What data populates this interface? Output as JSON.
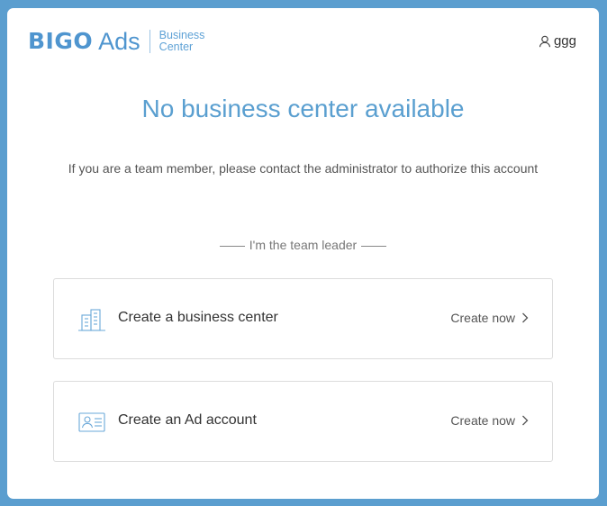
{
  "header": {
    "logo_brand": "BIGO",
    "logo_product": "Ads",
    "logo_sub_line1": "Business",
    "logo_sub_line2": "Center",
    "user_icon": "user-icon",
    "username": "ggg"
  },
  "main": {
    "title": "No business center available",
    "subtitle": "If you are a team member, please contact the administrator to authorize this account",
    "divider_label": "I'm the team leader"
  },
  "cards": [
    {
      "icon": "building-icon",
      "title": "Create a business center",
      "action": "Create now"
    },
    {
      "icon": "id-card-icon",
      "title": "Create an Ad account",
      "action": "Create now"
    }
  ],
  "colors": {
    "background": "#5b9ecf",
    "brand": "#4f95cf",
    "title": "#5a9fd0",
    "icon": "#6aa8d8"
  }
}
